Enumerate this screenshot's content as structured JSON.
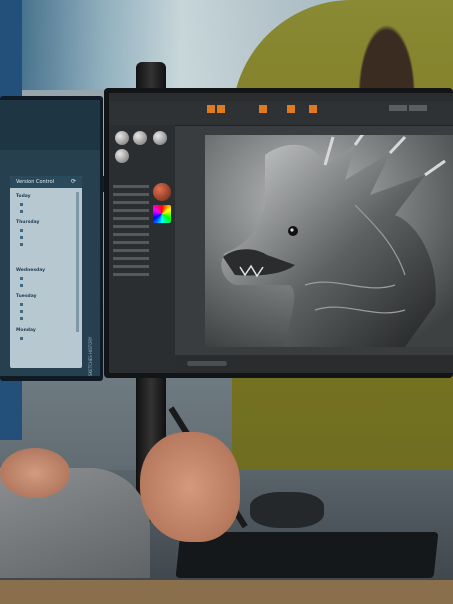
{
  "scene": {
    "description_colors": {
      "accent_orange": "#e07a1f",
      "screen_dark": "#3a3d40",
      "panel_blue": "#27404f"
    }
  },
  "right_monitor": {
    "app": {
      "menu": [
        "",
        "",
        "",
        "",
        "",
        "",
        "",
        "",
        "",
        ""
      ]
    },
    "canvas_image": "dragon-illustration"
  },
  "left_monitor": {
    "panel_title": "Version Control",
    "sync_icon": "refresh-icon",
    "side_label": "SKETCHES HISTORY",
    "groups": [
      {
        "day": "Today",
        "files": [
          "",
          ""
        ]
      },
      {
        "day": "Thursday",
        "files": [
          "",
          "",
          ""
        ]
      },
      {
        "day": "Wednesday",
        "files": [
          "",
          ""
        ]
      },
      {
        "day": "Tuesday",
        "files": [
          "",
          "",
          ""
        ]
      },
      {
        "day": "Monday",
        "files": [
          ""
        ]
      }
    ]
  }
}
